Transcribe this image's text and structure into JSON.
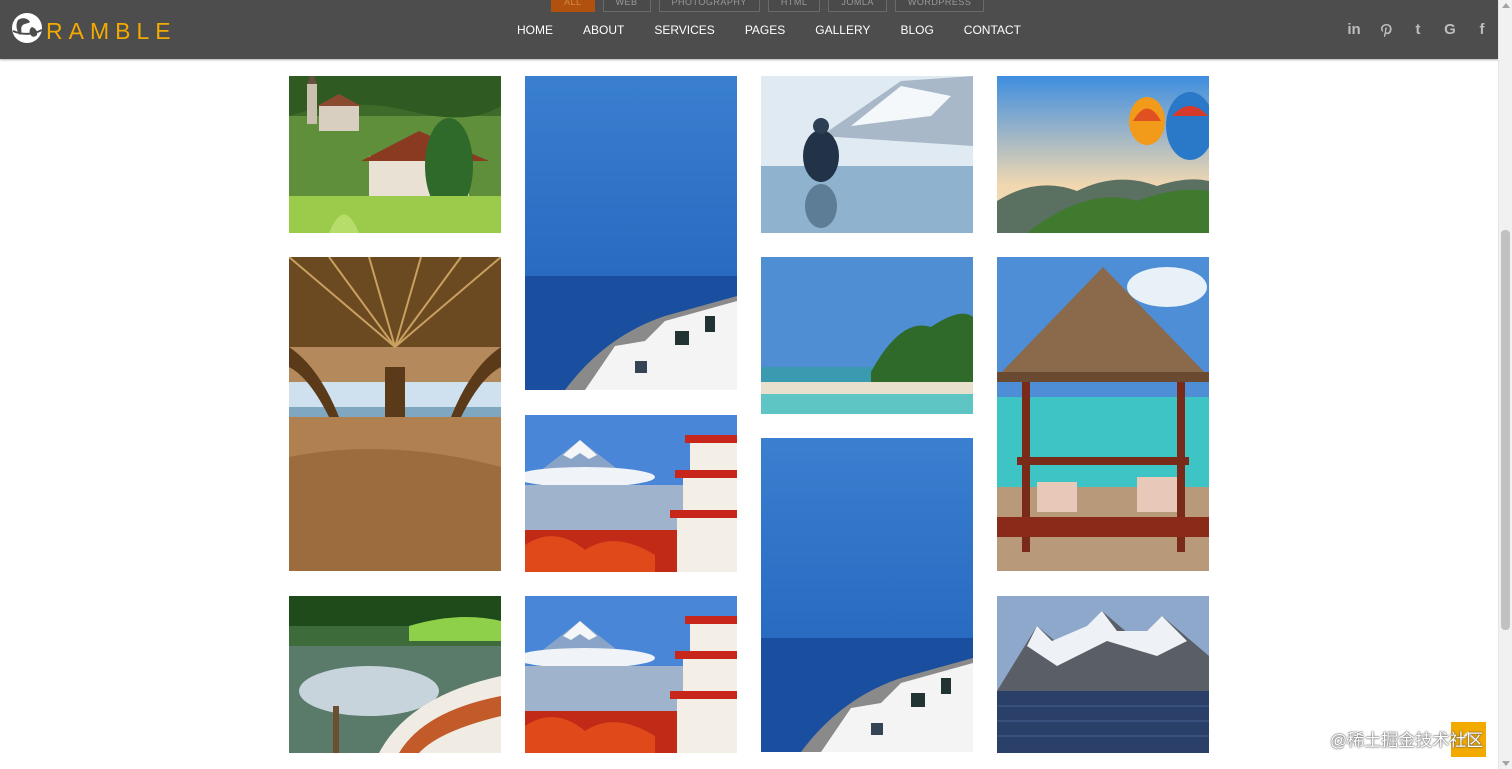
{
  "brand": {
    "name": "RAMBLE",
    "color": "#f2a900"
  },
  "filters": [
    {
      "label": "ALL",
      "active": true
    },
    {
      "label": "WEB"
    },
    {
      "label": "PHOTOGRAPHY"
    },
    {
      "label": "HTML"
    },
    {
      "label": "JOMLA"
    },
    {
      "label": "WORDPRESS"
    }
  ],
  "nav": {
    "home": "HOME",
    "about": "ABOUT",
    "services": "SERVICES",
    "pages": "PAGES",
    "gallery": "GALLERY",
    "blog": "BLOG",
    "contact": "CONTACT"
  },
  "social": {
    "linkedin": "in",
    "pinterest": "pinterest-icon",
    "tumblr": "t",
    "google": "G",
    "facebook": "f"
  },
  "gallery": {
    "items": [
      {
        "subject": "village-church"
      },
      {
        "subject": "santorini"
      },
      {
        "subject": "ice-meditation"
      },
      {
        "subject": "hot-air-balloons"
      },
      {
        "subject": "under-pier"
      },
      {
        "subject": "tropical-beach"
      },
      {
        "subject": "beach-gazebo"
      },
      {
        "subject": "fuji-pagoda"
      },
      {
        "subject": "santorini"
      },
      {
        "subject": "lake-boat"
      },
      {
        "subject": "fuji-pagoda"
      },
      {
        "subject": "snowy-mountains"
      }
    ]
  },
  "watermark": "@稀土掘金技术社区"
}
